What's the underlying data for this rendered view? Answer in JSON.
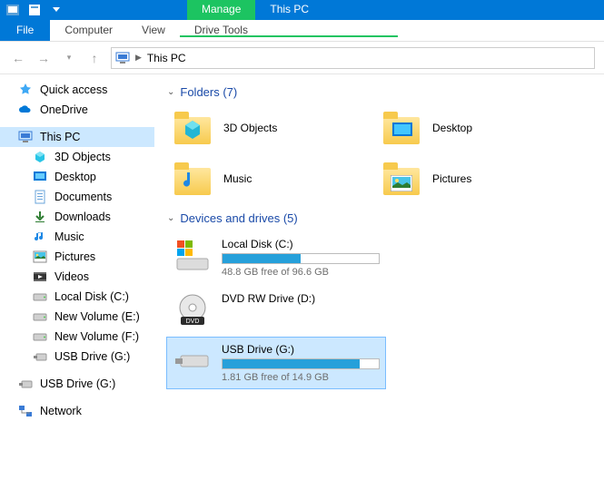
{
  "titlebar": {
    "context_tab": "Manage",
    "title": "This PC"
  },
  "ribbon": {
    "file": "File",
    "tabs": [
      "Computer",
      "View",
      "Drive Tools"
    ]
  },
  "address": {
    "location": "This PC"
  },
  "sidebar": {
    "items": [
      {
        "label": "Quick access",
        "icon": "star"
      },
      {
        "label": "OneDrive",
        "icon": "cloud"
      },
      {
        "label": "This PC",
        "icon": "pc",
        "selected": true
      },
      {
        "label": "3D Objects",
        "icon": "cube",
        "child": true
      },
      {
        "label": "Desktop",
        "icon": "desktop",
        "child": true
      },
      {
        "label": "Documents",
        "icon": "doc",
        "child": true
      },
      {
        "label": "Downloads",
        "icon": "down",
        "child": true
      },
      {
        "label": "Music",
        "icon": "music",
        "child": true
      },
      {
        "label": "Pictures",
        "icon": "pic",
        "child": true
      },
      {
        "label": "Videos",
        "icon": "vid",
        "child": true
      },
      {
        "label": "Local Disk (C:)",
        "icon": "disk",
        "child": true
      },
      {
        "label": "New Volume (E:)",
        "icon": "disk",
        "child": true
      },
      {
        "label": "New Volume (F:)",
        "icon": "disk",
        "child": true
      },
      {
        "label": "USB Drive (G:)",
        "icon": "usb",
        "child": true
      },
      {
        "label": "USB Drive (G:)",
        "icon": "usb"
      },
      {
        "label": "Network",
        "icon": "net"
      }
    ]
  },
  "main": {
    "folders_header": "Folders (7)",
    "folders": [
      {
        "label": "3D Objects",
        "overlay": "cube"
      },
      {
        "label": "Desktop",
        "overlay": "desktop"
      },
      {
        "label": "Music",
        "overlay": "music"
      },
      {
        "label": "Pictures",
        "overlay": "pic"
      }
    ],
    "drives_header": "Devices and drives (5)",
    "drives": [
      {
        "name": "Local Disk (C:)",
        "free": "48.8 GB free of 96.6 GB",
        "fill_pct": 50,
        "icon": "windisk"
      },
      {
        "name": "DVD RW Drive (D:)",
        "icon": "dvd",
        "nobar": true
      },
      {
        "name": "USB Drive (G:)",
        "free": "1.81 GB free of 14.9 GB",
        "fill_pct": 88,
        "icon": "usbdrive",
        "selected": true
      }
    ]
  }
}
